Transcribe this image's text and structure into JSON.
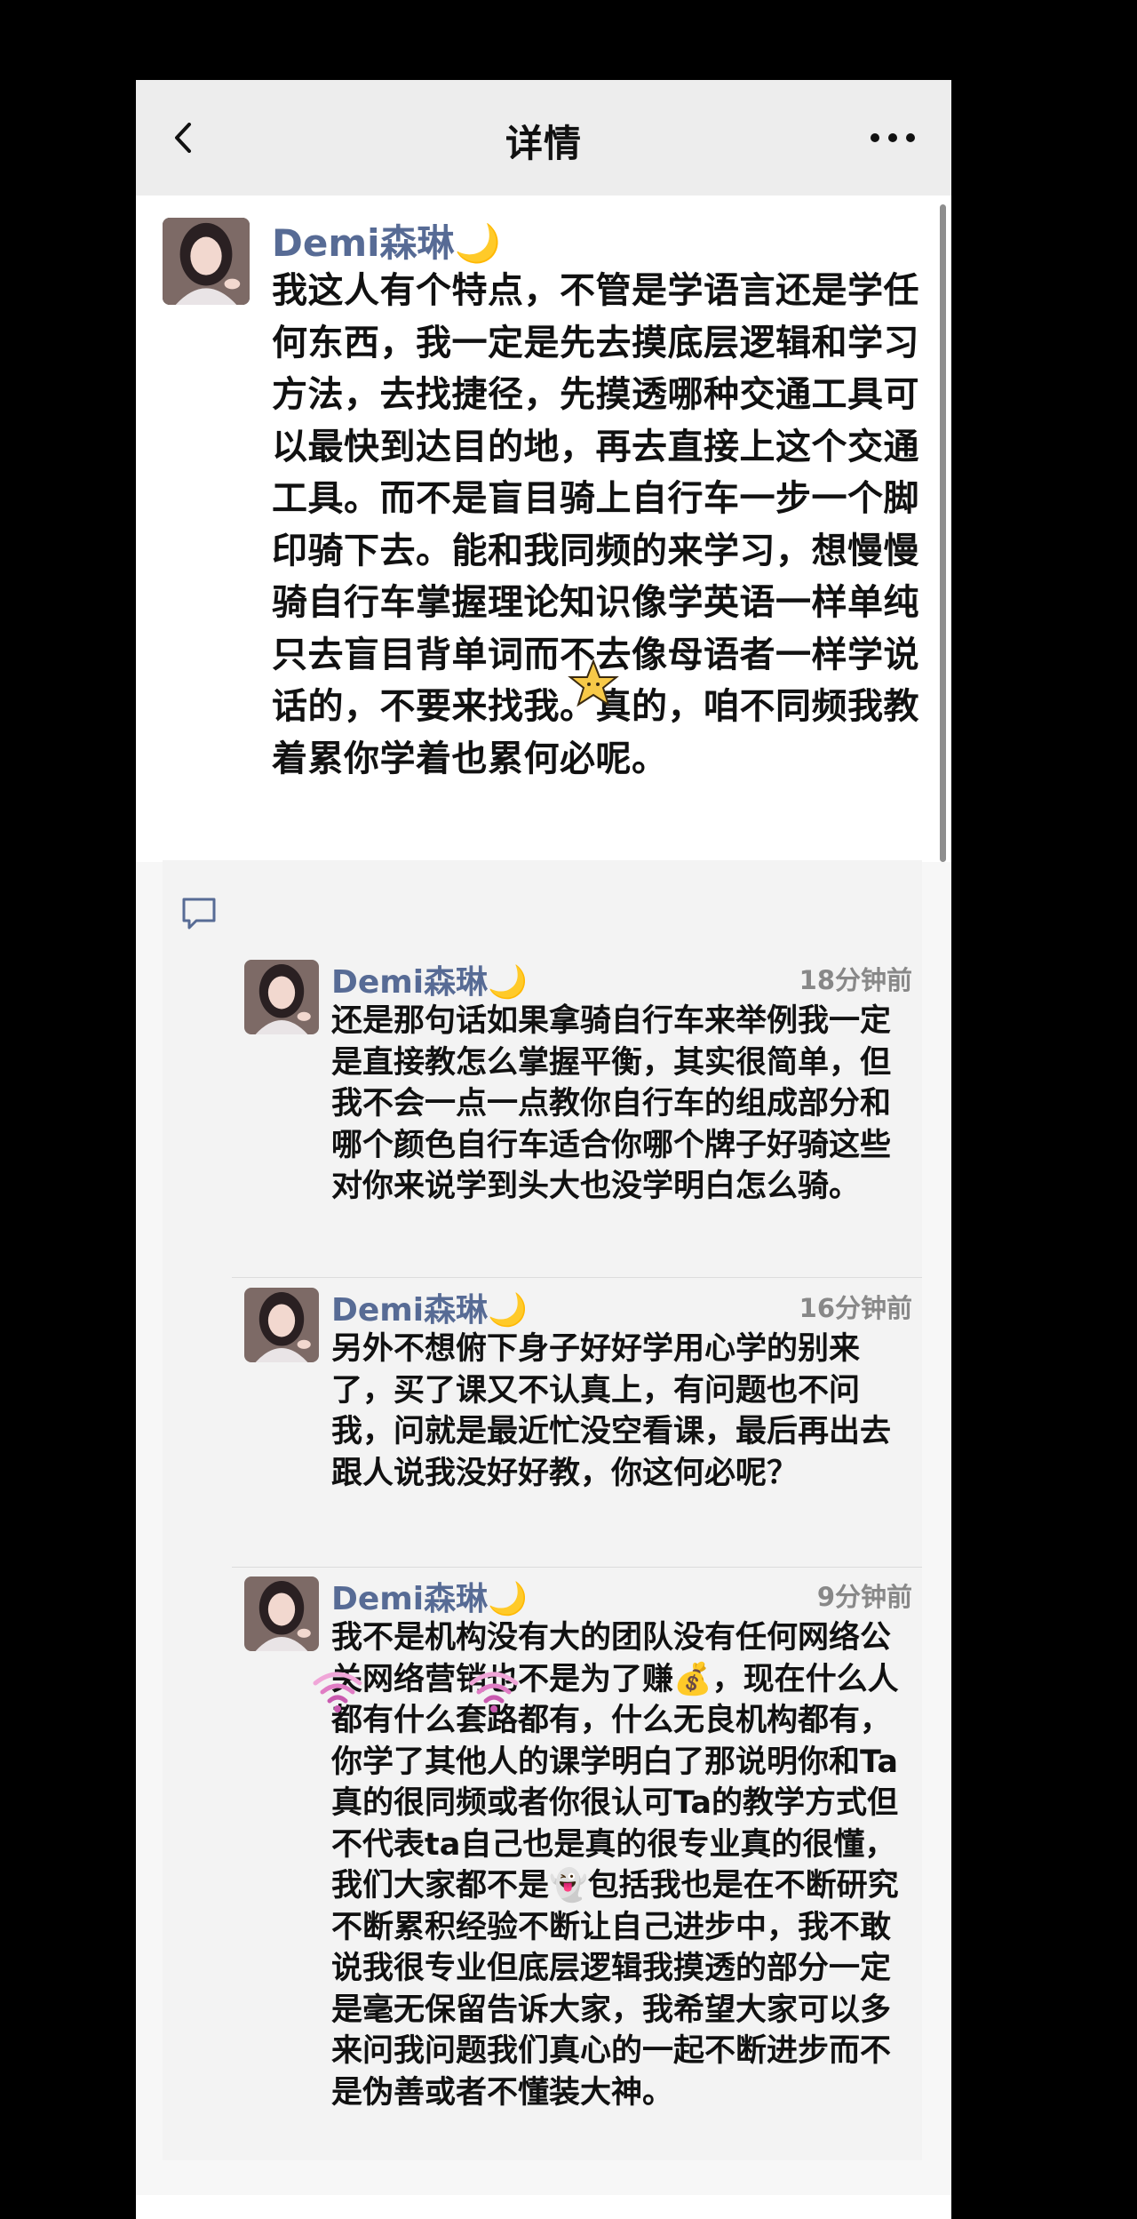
{
  "navbar": {
    "title": "详情"
  },
  "post": {
    "author": "Demi森琳",
    "author_emoji": "🌙",
    "text": "我这人有个特点，不管是学语言还是学任何东西，我一定是先去摸底层逻辑和学习方法，去找捷径，先摸透哪种交通工具可以最快到达目的地，再去直接上这个交通工具。而不是盲目骑上自行车一步一个脚印骑下去。能和我同频的来学习，想慢慢骑自行车掌握理论知识像学英语一样单纯只去盲目背单词而不去像母语者一样学说话的，不要来找我。真的，咱不同频我教着累你学着也累何必呢。"
  },
  "comments": [
    {
      "author": "Demi森琳",
      "author_emoji": "🌙",
      "time": "18分钟前",
      "text": "还是那句话如果拿骑自行车来举例我一定是直接教怎么掌握平衡，其实很简单，但我不会一点一点教你自行车的组成部分和哪个颜色自行车适合你哪个牌子好骑这些对你来说学到头大也没学明白怎么骑。"
    },
    {
      "author": "Demi森琳",
      "author_emoji": "🌙",
      "time": "16分钟前",
      "text": "另外不想俯下身子好好学用心学的别来了，买了课又不认真上，有问题也不问我，问就是最近忙没空看课，最后再出去跟人说我没好好教，你这何必呢？"
    },
    {
      "author": "Demi森琳",
      "author_emoji": "🌙",
      "time": "9分钟前",
      "text": "我不是机构没有大的团队没有任何网络公关网络营销也不是为了赚💰，现在什么人都有什么套路都有，什么无良机构都有，你学了其他人的课学明白了那说明你和Ta真的很同频或者你很认可Ta的教学方式但不代表ta自己也是真的很专业真的很懂，我们大家都不是👻包括我也是在不断研究不断累积经验不断让自己进步中，我不敢说我很专业但底层逻辑我摸透的部分一定是毫无保留告诉大家，我希望大家可以多来问我问题我们真心的一起不断进步而不是伪善或者不懂装大神。"
    }
  ],
  "icons": {
    "back": "chevron-left-icon",
    "more": "more-dots-icon",
    "comment": "comment-bubble-icon",
    "sticker_star": "star-sticker-icon",
    "sticker_wifi": "wifi-sticker-icon"
  },
  "colors": {
    "author": "#576b95",
    "navbar_bg": "#ededed",
    "comments_bg": "#f3f3f3"
  }
}
